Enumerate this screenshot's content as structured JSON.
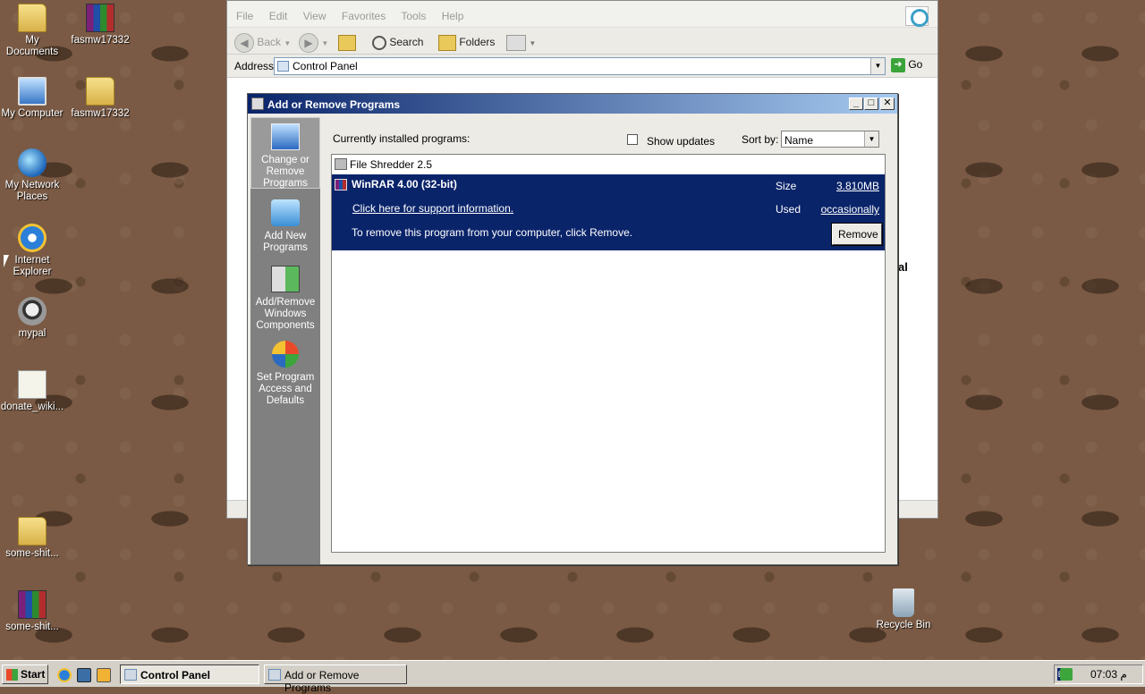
{
  "desktop": {
    "icons": [
      {
        "label": "My Documents",
        "icon": "folder-icon"
      },
      {
        "label": "fasmw17332",
        "icon": "winrar-icon"
      },
      {
        "label": "My Computer",
        "icon": "computer-icon"
      },
      {
        "label": "fasmw17332",
        "icon": "folder-icon"
      },
      {
        "label": "My Network Places",
        "icon": "network-icon"
      },
      {
        "label": "Internet Explorer",
        "icon": "ie-icon"
      },
      {
        "label": "mypal",
        "icon": "mypal-icon"
      },
      {
        "label": "donate_wiki...",
        "icon": "certificate-icon"
      },
      {
        "label": "some-shit...",
        "icon": "folder-icon"
      },
      {
        "label": "some-shit...",
        "icon": "winrar-icon"
      },
      {
        "label": "Recycle Bin",
        "icon": "recycle-bin-icon"
      }
    ]
  },
  "control_panel": {
    "menu": [
      "File",
      "Edit",
      "View",
      "Favorites",
      "Tools",
      "Help"
    ],
    "toolbar": {
      "back": "Back",
      "search": "Search",
      "folders": "Folders"
    },
    "address": {
      "label": "Address",
      "value": "Control Panel",
      "go": "Go"
    },
    "side_text": "al"
  },
  "arp": {
    "title": "Add or Remove Programs",
    "sidebar": [
      {
        "label": "Change or Remove Programs",
        "icon": "change-remove-icon"
      },
      {
        "label": "Add New Programs",
        "icon": "add-new-icon"
      },
      {
        "label": "Add/Remove Windows Components",
        "icon": "windows-components-icon"
      },
      {
        "label": "Set Program Access and Defaults",
        "icon": "program-access-icon"
      }
    ],
    "installed_label": "Currently installed programs:",
    "show_updates": "Show updates",
    "sort_by_label": "Sort by:",
    "sort_by_value": "Name",
    "programs": [
      {
        "name": "File Shredder 2.5"
      },
      {
        "name": "WinRAR 4.00 (32-bit)",
        "size_label": "Size",
        "size_value": "3.810MB",
        "used_label": "Used",
        "used_value": "occasionally",
        "support_link": "Click here for support information.",
        "remove_msg": "To remove this program from your computer, click Remove.",
        "remove_button": "Remove"
      }
    ]
  },
  "taskbar": {
    "start": "Start",
    "tasks": [
      "Control Panel",
      "Add or Remove Programs"
    ],
    "lang": "EN",
    "clock": "07:03 م"
  },
  "colors": {
    "selection": "#0a246a",
    "title_start": "#0a246a",
    "title_end": "#a6caf0"
  }
}
